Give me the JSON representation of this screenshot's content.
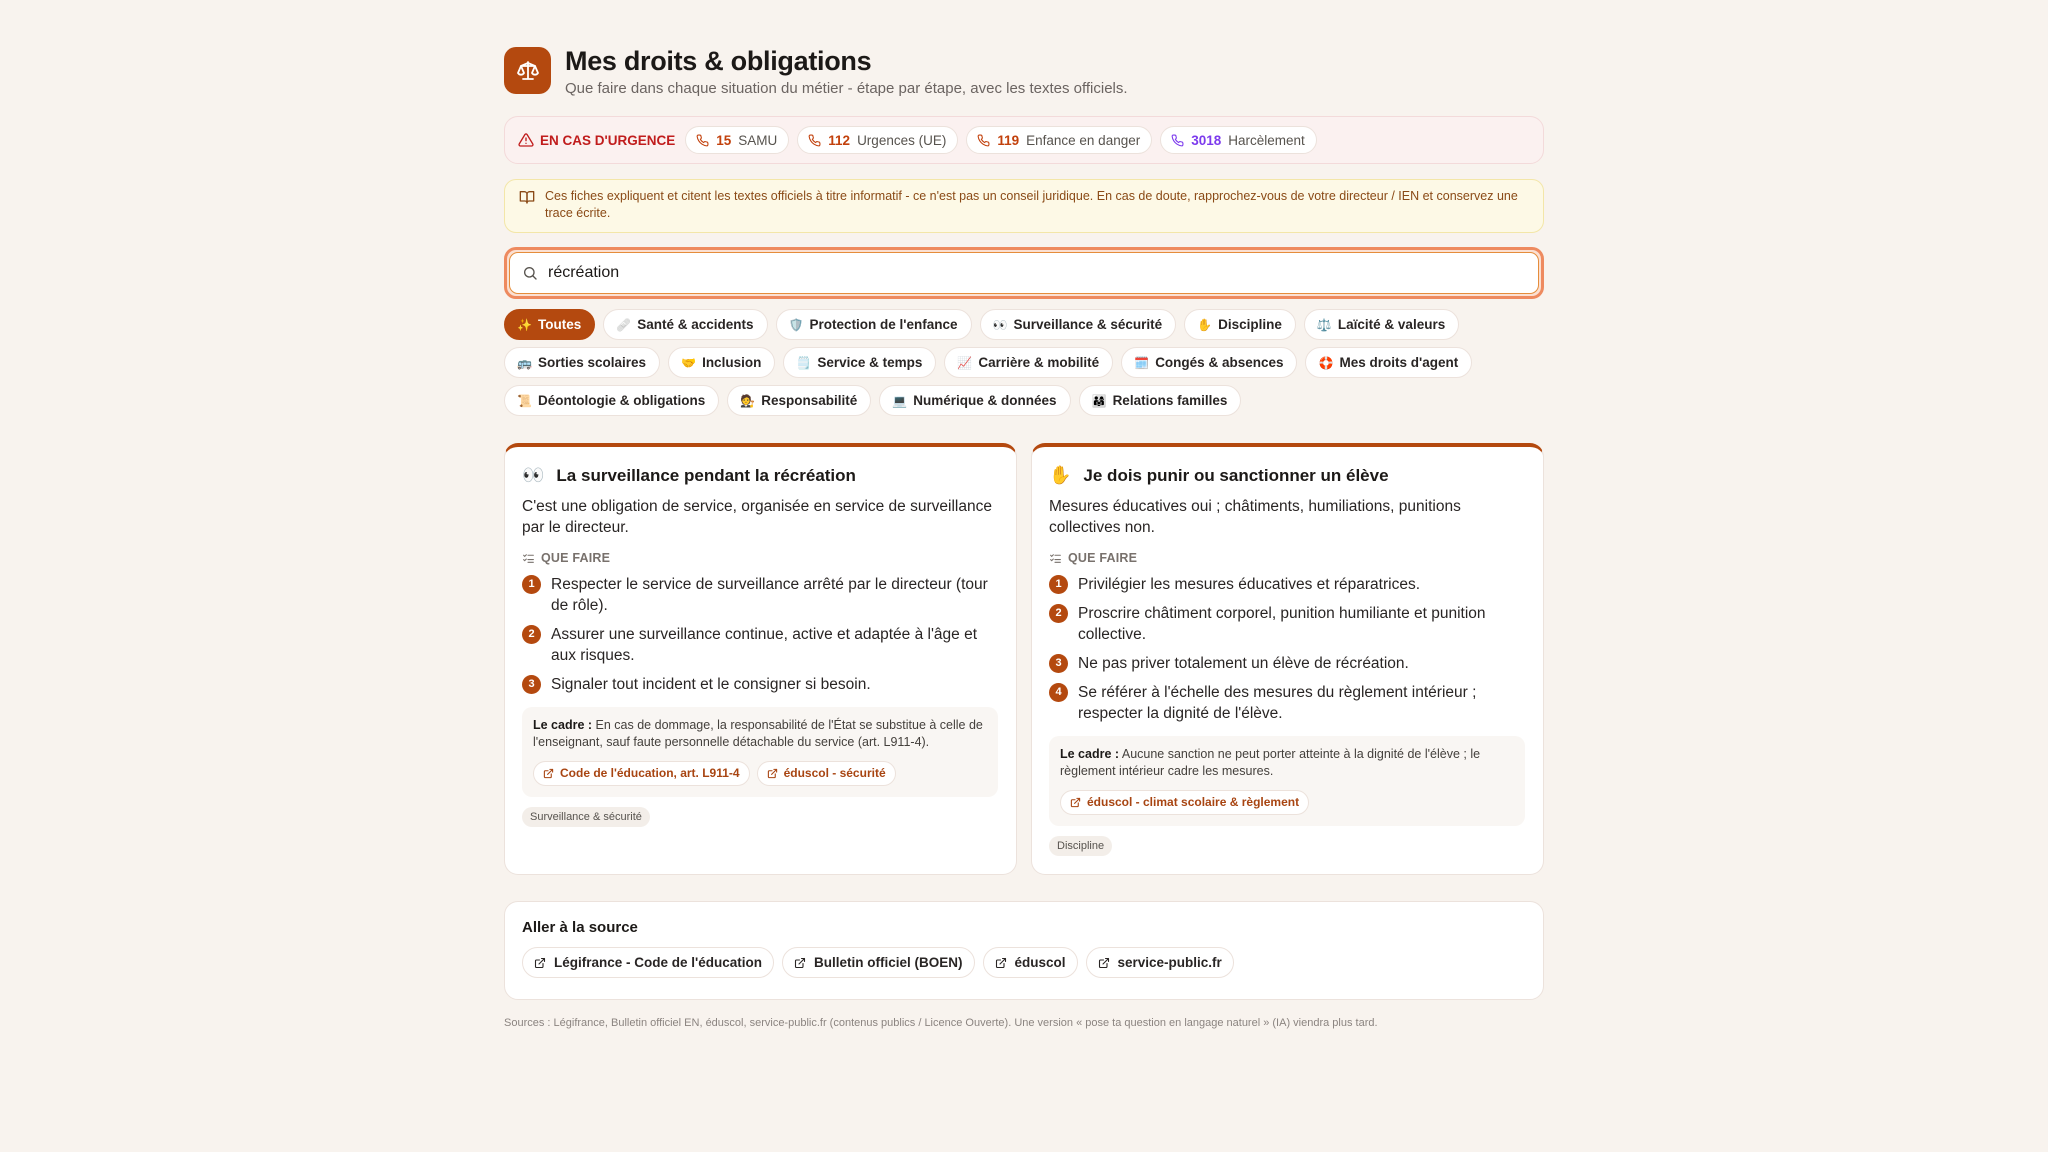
{
  "header": {
    "title": "Mes droits & obligations",
    "subtitle": "Que faire dans chaque situation du métier - étape par étape, avec les textes officiels."
  },
  "emergency": {
    "label": "EN CAS D'URGENCE",
    "numbers": [
      {
        "number": "15",
        "label": "SAMU"
      },
      {
        "number": "112",
        "label": "Urgences (UE)"
      },
      {
        "number": "119",
        "label": "Enfance en danger"
      },
      {
        "number": "3018",
        "label": "Harcèlement"
      }
    ]
  },
  "disclaimer": "Ces fiches expliquent et citent les textes officiels à titre informatif - ce n'est pas un conseil juridique. En cas de doute, rapprochez-vous de votre directeur / IEN et conservez une trace écrite.",
  "search": {
    "value": "récréation"
  },
  "categories": [
    {
      "emoji": "✨",
      "label": "Toutes"
    },
    {
      "emoji": "🩹",
      "label": "Santé & accidents"
    },
    {
      "emoji": "🛡️",
      "label": "Protection de l'enfance"
    },
    {
      "emoji": "👀",
      "label": "Surveillance & sécurité"
    },
    {
      "emoji": "✋",
      "label": "Discipline"
    },
    {
      "emoji": "⚖️",
      "label": "Laïcité & valeurs"
    },
    {
      "emoji": "🚌",
      "label": "Sorties scolaires"
    },
    {
      "emoji": "🤝",
      "label": "Inclusion"
    },
    {
      "emoji": "🗒️",
      "label": "Service & temps"
    },
    {
      "emoji": "📈",
      "label": "Carrière & mobilité"
    },
    {
      "emoji": "🗓️",
      "label": "Congés & absences"
    },
    {
      "emoji": "🛟",
      "label": "Mes droits d'agent"
    },
    {
      "emoji": "📜",
      "label": "Déontologie & obligations"
    },
    {
      "emoji": "🧑‍⚖️",
      "label": "Responsabilité"
    },
    {
      "emoji": "💻",
      "label": "Numérique & données"
    },
    {
      "emoji": "👨‍👩‍👧",
      "label": "Relations familles"
    }
  ],
  "cards": [
    {
      "emoji": "👀",
      "title": "La surveillance pendant la récréation",
      "description": "C'est une obligation de service, organisée en service de surveillance par le directeur.",
      "what_to_do_label": "QUE FAIRE",
      "steps": [
        "Respecter le service de surveillance arrêté par le directeur (tour de rôle).",
        "Assurer une surveillance continue, active et adaptée à l'âge et aux risques.",
        "Signaler tout incident et le consigner si besoin."
      ],
      "cadre_label": "Le cadre :",
      "cadre_text": "En cas de dommage, la responsabilité de l'État se substitue à celle de l'enseignant, sauf faute personnelle détachable du service (art. L911-4).",
      "refs": [
        "Code de l'éducation, art. L911-4",
        "éduscol - sécurité"
      ],
      "tag": "Surveillance & sécurité"
    },
    {
      "emoji": "✋",
      "title": "Je dois punir ou sanctionner un élève",
      "description": "Mesures éducatives oui ; châtiments, humiliations, punitions collectives non.",
      "what_to_do_label": "QUE FAIRE",
      "steps": [
        "Privilégier les mesures éducatives et réparatrices.",
        "Proscrire châtiment corporel, punition humiliante et punition collective.",
        "Ne pas priver totalement un élève de récréation.",
        "Se référer à l'échelle des mesures du règlement intérieur ; respecter la dignité de l'élève."
      ],
      "cadre_label": "Le cadre :",
      "cadre_text": "Aucune sanction ne peut porter atteinte à la dignité de l'élève ; le règlement intérieur cadre les mesures.",
      "refs": [
        "éduscol - climat scolaire & règlement"
      ],
      "tag": "Discipline"
    }
  ],
  "sources": {
    "title": "Aller à la source",
    "links": [
      "Légifrance - Code de l'éducation",
      "Bulletin officiel (BOEN)",
      "éduscol",
      "service-public.fr"
    ]
  },
  "footnote": "Sources : Légifrance, Bulletin officiel EN, éduscol, service-public.fr (contenus publics / Licence Ouverte). Une version « pose ta question en langage naturel » (IA) viendra plus tard.",
  "colors": {
    "accent": "#b4490f",
    "emergency": "#c01c1c",
    "background": "#f8f3ee"
  }
}
